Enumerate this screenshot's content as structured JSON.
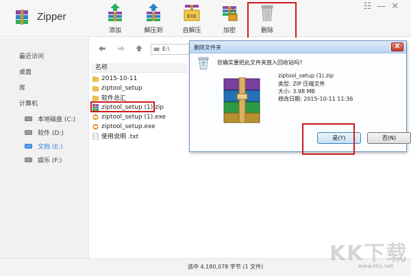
{
  "app": {
    "title": "Zipper"
  },
  "toolbar": {
    "items": [
      {
        "label": "添加",
        "icon": "add-archive-icon"
      },
      {
        "label": "解压到",
        "icon": "extract-to-icon"
      },
      {
        "label": "自解压",
        "icon": "self-extract-exe-icon"
      },
      {
        "label": "加密",
        "icon": "encrypt-lock-icon"
      },
      {
        "label": "删除",
        "icon": "delete-trash-icon"
      }
    ],
    "exe_badge": "EXE"
  },
  "window_controls": {
    "menu": "☷",
    "minimize": "—",
    "close": "✕"
  },
  "sidebar": {
    "nav": [
      {
        "label": "最近访问"
      },
      {
        "label": "桌面"
      },
      {
        "label": "库"
      },
      {
        "label": "计算机"
      }
    ],
    "drives": [
      {
        "label": "本地磁盘 (C:)",
        "active": false
      },
      {
        "label": "软件 (D:)",
        "active": false
      },
      {
        "label": "文档 (E:)",
        "active": true
      },
      {
        "label": "娱乐 (F:)",
        "active": false
      }
    ]
  },
  "address": {
    "path": "E:\\"
  },
  "file_list": {
    "column_header": "名称",
    "files": [
      {
        "name": "2015-10-11",
        "type": "folder"
      },
      {
        "name": "ziptool_setup",
        "type": "folder"
      },
      {
        "name": "软件总汇",
        "type": "folder"
      },
      {
        "name": "ziptool_setup (1).zip",
        "type": "zip",
        "selected": true
      },
      {
        "name": "ziptool_setup (1).exe",
        "type": "exe"
      },
      {
        "name": "ziptool_setup.exe",
        "type": "exe"
      },
      {
        "name": "使用说明 .txt",
        "type": "txt"
      }
    ]
  },
  "status": {
    "text": "选中 4,180,078 字节 (1 文件)"
  },
  "dialog": {
    "title": "删除文件夹",
    "close": "X",
    "question": "您确实要把此文件夹放入回收站吗?",
    "file_name": "ziptool_setup (1).zip",
    "file_type": "类型: ZIP 压缩文件",
    "file_size": "大小: 3.98 MB",
    "modified": "修改日期: 2015-10-11 11:36",
    "yes_label": "是(Y)",
    "no_label": "否(N)"
  },
  "watermark": {
    "text": "KK下载",
    "url": "www.kkx.net"
  },
  "colors": {
    "highlight_red": "#d0161b",
    "active_drive": "#2b7fd8",
    "dialog_title": "#bcd6f2"
  }
}
